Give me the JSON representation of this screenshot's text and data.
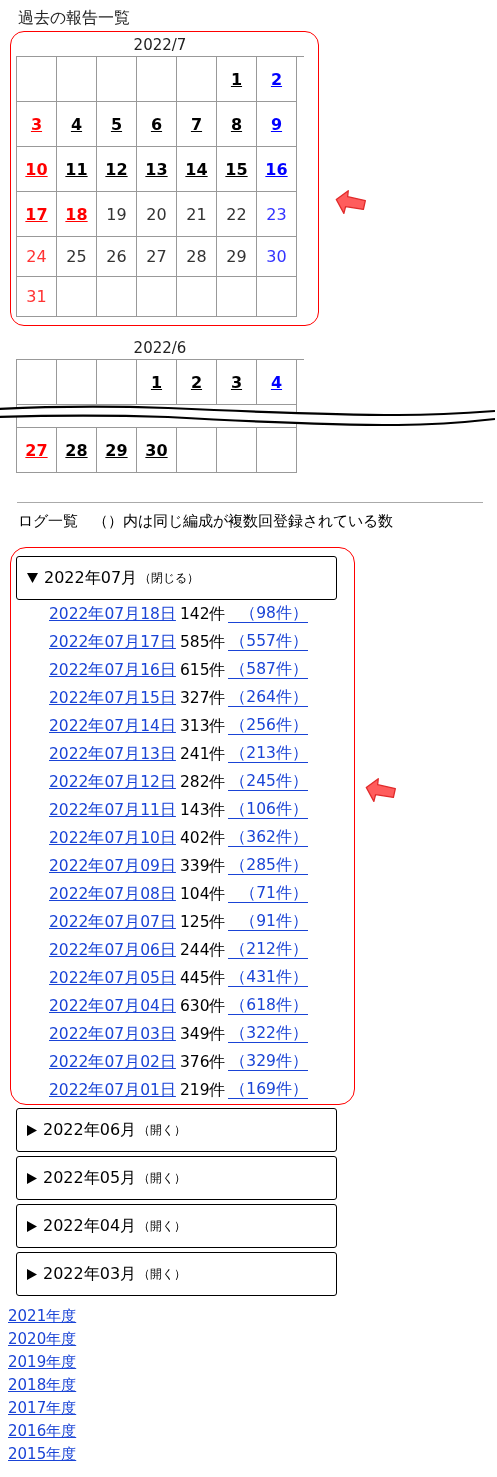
{
  "title": "過去の報告一覧",
  "calendars": [
    {
      "caption": "2022/7",
      "highlighted": true,
      "rows": [
        {
          "kind": "week",
          "cells": [
            {
              "kind": "blank"
            },
            {
              "kind": "blank"
            },
            {
              "kind": "blank"
            },
            {
              "kind": "blank"
            },
            {
              "kind": "blank"
            },
            {
              "kind": "day",
              "day": "1",
              "link": true,
              "color": "#000000"
            },
            {
              "kind": "day",
              "day": "2",
              "link": true,
              "color": "#0000ff"
            }
          ]
        },
        {
          "kind": "week",
          "cells": [
            {
              "kind": "day",
              "day": "3",
              "link": true,
              "color": "#ff0000"
            },
            {
              "kind": "day",
              "day": "4",
              "link": true,
              "color": "#000000"
            },
            {
              "kind": "day",
              "day": "5",
              "link": true,
              "color": "#000000"
            },
            {
              "kind": "day",
              "day": "6",
              "link": true,
              "color": "#000000"
            },
            {
              "kind": "day",
              "day": "7",
              "link": true,
              "color": "#000000"
            },
            {
              "kind": "day",
              "day": "8",
              "link": true,
              "color": "#000000"
            },
            {
              "kind": "day",
              "day": "9",
              "link": true,
              "color": "#0000ff"
            }
          ]
        },
        {
          "kind": "week",
          "cells": [
            {
              "kind": "day",
              "day": "10",
              "link": true,
              "color": "#ff0000"
            },
            {
              "kind": "day",
              "day": "11",
              "link": true,
              "color": "#000000"
            },
            {
              "kind": "day",
              "day": "12",
              "link": true,
              "color": "#000000"
            },
            {
              "kind": "day",
              "day": "13",
              "link": true,
              "color": "#000000"
            },
            {
              "kind": "day",
              "day": "14",
              "link": true,
              "color": "#000000"
            },
            {
              "kind": "day",
              "day": "15",
              "link": true,
              "color": "#000000"
            },
            {
              "kind": "day",
              "day": "16",
              "link": true,
              "color": "#0000ff"
            }
          ]
        },
        {
          "kind": "week",
          "cells": [
            {
              "kind": "day",
              "day": "17",
              "link": true,
              "color": "#ff0000"
            },
            {
              "kind": "day",
              "day": "18",
              "link": true,
              "color": "#ff0000"
            },
            {
              "kind": "day",
              "day": "19",
              "link": false,
              "color": "#333333"
            },
            {
              "kind": "day",
              "day": "20",
              "link": false,
              "color": "#333333"
            },
            {
              "kind": "day",
              "day": "21",
              "link": false,
              "color": "#333333"
            },
            {
              "kind": "day",
              "day": "22",
              "link": false,
              "color": "#333333"
            },
            {
              "kind": "day",
              "day": "23",
              "link": false,
              "color": "#3333ff"
            }
          ]
        },
        {
          "kind": "week",
          "cells": [
            {
              "kind": "day",
              "day": "24",
              "link": false,
              "color": "#ff3333"
            },
            {
              "kind": "day",
              "day": "25",
              "link": false,
              "color": "#333333"
            },
            {
              "kind": "day",
              "day": "26",
              "link": false,
              "color": "#333333"
            },
            {
              "kind": "day",
              "day": "27",
              "link": false,
              "color": "#333333"
            },
            {
              "kind": "day",
              "day": "28",
              "link": false,
              "color": "#333333"
            },
            {
              "kind": "day",
              "day": "29",
              "link": false,
              "color": "#333333"
            },
            {
              "kind": "day",
              "day": "30",
              "link": false,
              "color": "#3333ff"
            }
          ]
        },
        {
          "kind": "week",
          "cells": [
            {
              "kind": "day",
              "day": "31",
              "link": false,
              "color": "#ff3333"
            },
            {
              "kind": "blank"
            },
            {
              "kind": "blank"
            },
            {
              "kind": "blank"
            },
            {
              "kind": "blank"
            },
            {
              "kind": "blank"
            },
            {
              "kind": "blank"
            }
          ]
        }
      ]
    },
    {
      "caption": "2022/6",
      "rows": [
        {
          "kind": "week",
          "cells": [
            {
              "kind": "blank"
            },
            {
              "kind": "blank"
            },
            {
              "kind": "blank"
            },
            {
              "kind": "day",
              "day": "1",
              "link": true,
              "color": "#000000"
            },
            {
              "kind": "day",
              "day": "2",
              "link": true,
              "color": "#000000"
            },
            {
              "kind": "day",
              "day": "3",
              "link": true,
              "color": "#000000"
            },
            {
              "kind": "day",
              "day": "4",
              "link": true,
              "color": "#0000ff"
            }
          ]
        },
        {
          "kind": "break"
        },
        {
          "kind": "week",
          "cells": [
            {
              "kind": "day",
              "day": "27",
              "link": true,
              "color": "#ff0000"
            },
            {
              "kind": "day",
              "day": "28",
              "link": true,
              "color": "#000000"
            },
            {
              "kind": "day",
              "day": "29",
              "link": true,
              "color": "#000000"
            },
            {
              "kind": "day",
              "day": "30",
              "link": true,
              "color": "#000000"
            },
            {
              "kind": "blank"
            },
            {
              "kind": "blank"
            },
            {
              "kind": "blank"
            }
          ]
        }
      ]
    }
  ],
  "log_heading": "ログ一覧　（）内は同じ編成が複数回登録されている数",
  "months": [
    {
      "label": "2022年07月",
      "toggle": "（閉じる）",
      "expanded": true,
      "highlighted": true,
      "entries": [
        {
          "date": "2022年07月18日",
          "count": "142件",
          "duplicates": "（98件）"
        },
        {
          "date": "2022年07月17日",
          "count": "585件",
          "duplicates": "（557件）"
        },
        {
          "date": "2022年07月16日",
          "count": "615件",
          "duplicates": "（587件）"
        },
        {
          "date": "2022年07月15日",
          "count": "327件",
          "duplicates": "（264件）"
        },
        {
          "date": "2022年07月14日",
          "count": "313件",
          "duplicates": "（256件）"
        },
        {
          "date": "2022年07月13日",
          "count": "241件",
          "duplicates": "（213件）"
        },
        {
          "date": "2022年07月12日",
          "count": "282件",
          "duplicates": "（245件）"
        },
        {
          "date": "2022年07月11日",
          "count": "143件",
          "duplicates": "（106件）"
        },
        {
          "date": "2022年07月10日",
          "count": "402件",
          "duplicates": "（362件）"
        },
        {
          "date": "2022年07月09日",
          "count": "339件",
          "duplicates": "（285件）"
        },
        {
          "date": "2022年07月08日",
          "count": "104件",
          "duplicates": "（71件）"
        },
        {
          "date": "2022年07月07日",
          "count": "125件",
          "duplicates": "（91件）"
        },
        {
          "date": "2022年07月06日",
          "count": "244件",
          "duplicates": "（212件）"
        },
        {
          "date": "2022年07月05日",
          "count": "445件",
          "duplicates": "（431件）"
        },
        {
          "date": "2022年07月04日",
          "count": "630件",
          "duplicates": "（618件）"
        },
        {
          "date": "2022年07月03日",
          "count": "349件",
          "duplicates": "（322件）"
        },
        {
          "date": "2022年07月02日",
          "count": "376件",
          "duplicates": "（329件）"
        },
        {
          "date": "2022年07月01日",
          "count": "219件",
          "duplicates": "（169件）"
        }
      ]
    },
    {
      "label": "2022年06月",
      "toggle": "（開く）",
      "expanded": false
    },
    {
      "label": "2022年05月",
      "toggle": "（開く）",
      "expanded": false
    },
    {
      "label": "2022年04月",
      "toggle": "（開く）",
      "expanded": false
    },
    {
      "label": "2022年03月",
      "toggle": "（開く）",
      "expanded": false
    }
  ],
  "years": [
    "2021年度",
    "2020年度",
    "2019年度",
    "2018年度",
    "2017年度",
    "2016年度",
    "2015年度"
  ]
}
